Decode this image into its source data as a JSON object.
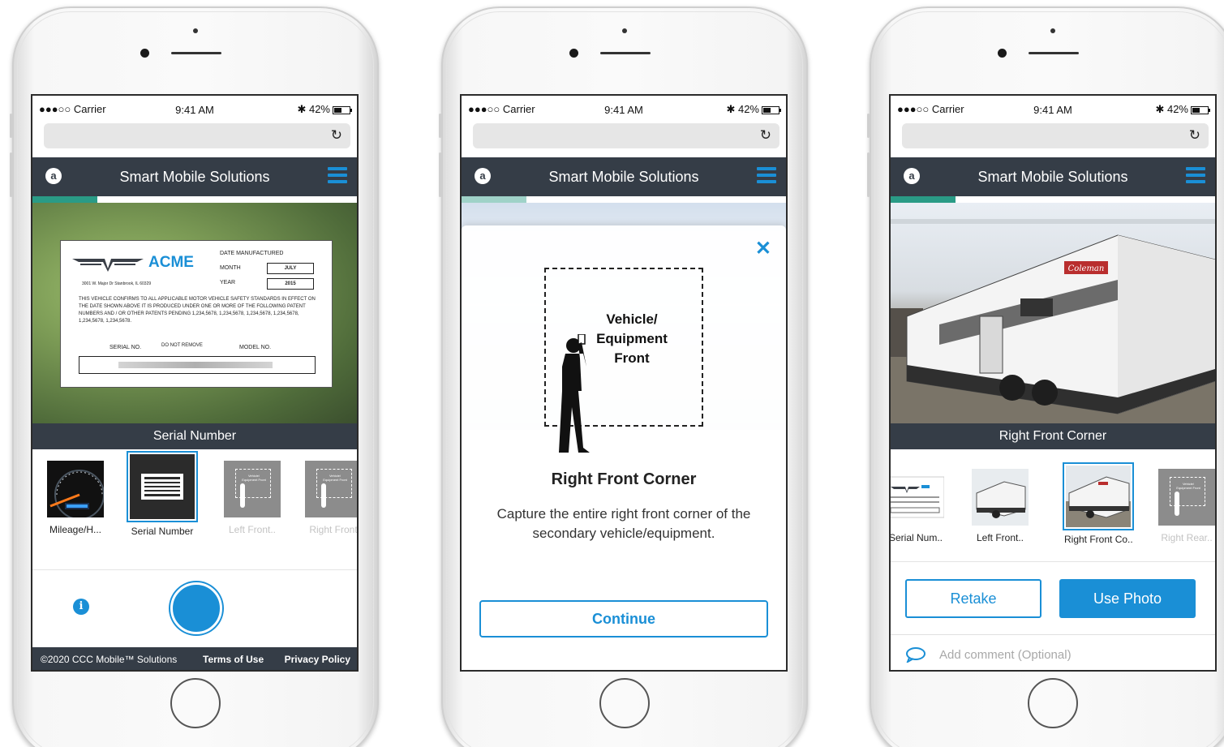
{
  "status_bar": {
    "carrier": "●●●○○ Carrier",
    "time": "9:41 AM",
    "battery": "42%",
    "bluetooth": "✱"
  },
  "app": {
    "title": "Smart Mobile Solutions",
    "badge_letter": "a",
    "reload_glyph": "↻",
    "accent_color": "#1a8fd6",
    "header_color": "#353d47",
    "progress_color": "#2a9b86"
  },
  "screen1": {
    "caption": "Serial Number",
    "thumbnails": [
      {
        "label": "Mileage/H...",
        "state": "done"
      },
      {
        "label": "Serial Number",
        "state": "selected"
      },
      {
        "label": "Left Front..",
        "state": "pending"
      },
      {
        "label": "Right Front",
        "state": "pending"
      }
    ],
    "info_glyph": "i",
    "label_card": {
      "brand": "ACME",
      "address": "3001 W. Major Dr Stanbrook, IL 60329",
      "date_manufactured": "DATE MANUFACTURED",
      "month_label": "MONTH",
      "month_value": "JULY",
      "year_label": "YEAR",
      "year_value": "2015",
      "body": "THIS VEHICLE CONFIRMS TO ALL APPLICABLE MOTOR VEHICLE SAFETY STANDARDS IN EFFECT ON THE DATE SHOWN ABOVE IT IS PRODUCED UNDER ONE OR MORE OF THE FOLLOWING PATENT NUMBERS AND / OR OTHER PATENTS PENDING 1,234,5678, 1,234,5678, 1,234,5678, 1,234,5678, 1,234,5678, 1,234,5678.",
      "serial_label": "SERIAL NO.",
      "do_not_remove": "DO NOT REMOVE",
      "model_label": "MODEL NO."
    },
    "placeholder_text": "Vehicle/ Equipment Front"
  },
  "screen2": {
    "frame_text": "Vehicle/ Equipment Front",
    "close_glyph": "✕",
    "heading": "Right Front Corner",
    "description": "Capture the entire right front corner of the secondary vehicle/equipment.",
    "continue_label": "Continue"
  },
  "screen3": {
    "caption": "Right Front Corner",
    "thumbnails": [
      {
        "label": "Serial Num..",
        "state": "done"
      },
      {
        "label": "Left Front..",
        "state": "done"
      },
      {
        "label": "Right Front Co..",
        "state": "selected"
      },
      {
        "label": "Right Rear..",
        "state": "pending"
      }
    ],
    "retake_label": "Retake",
    "use_photo_label": "Use Photo",
    "comment_placeholder": "Add comment (Optional)",
    "trailer_brand": "Coleman"
  },
  "footer": {
    "copyright": "©2020 CCC Mobile™ Solutions",
    "terms": "Terms of Use",
    "privacy": "Privacy Policy"
  }
}
